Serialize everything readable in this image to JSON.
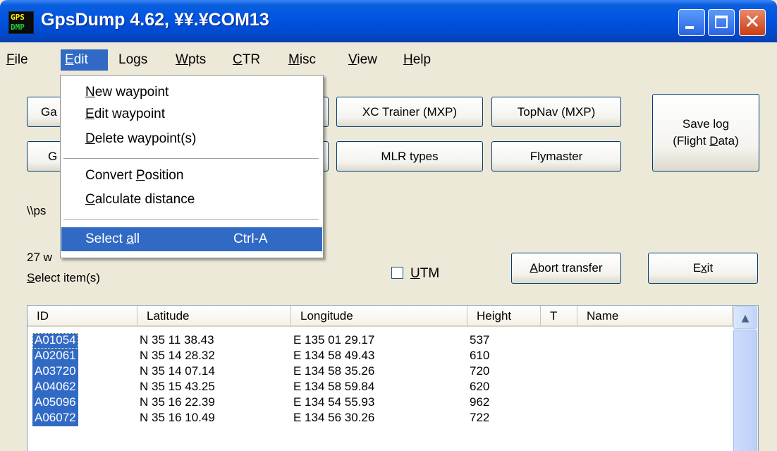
{
  "window": {
    "title": "GpsDump 4.62, ¥¥.¥COM13",
    "icon_text_top": "GPS",
    "icon_text_bottom": "DMP",
    "close_glyph": "✕"
  },
  "menubar": [
    {
      "pre": "",
      "mn": "F",
      "post": "ile"
    },
    {
      "pre": "",
      "mn": "E",
      "post": "dit"
    },
    {
      "pre": "Lo",
      "mn": "g",
      "post": "s"
    },
    {
      "pre": "",
      "mn": "W",
      "post": "pts"
    },
    {
      "pre": "",
      "mn": "C",
      "post": "TR"
    },
    {
      "pre": "",
      "mn": "M",
      "post": "isc"
    },
    {
      "pre": "",
      "mn": "V",
      "post": "iew"
    },
    {
      "pre": "",
      "mn": "H",
      "post": "elp"
    }
  ],
  "edit_menu": {
    "items": [
      {
        "pre": "",
        "mn": "N",
        "post": "ew waypoint",
        "shortcut": ""
      },
      {
        "pre": "",
        "mn": "E",
        "post": "dit waypoint",
        "shortcut": ""
      },
      {
        "pre": "",
        "mn": "D",
        "post": "elete waypoint(s)",
        "shortcut": ""
      },
      {
        "pre": "Convert ",
        "mn": "P",
        "post": "osition",
        "shortcut": ""
      },
      {
        "pre": "",
        "mn": "C",
        "post": "alculate distance",
        "shortcut": ""
      },
      {
        "pre": "Select ",
        "mn": "a",
        "post": "ll",
        "shortcut": "Ctrl-A"
      }
    ]
  },
  "buttons": {
    "left_top_partial": "Ga",
    "left_bottom_partial": "G",
    "xc_trainer": "XC Trainer (MXP)",
    "topnav": "TopNav (MXP)",
    "mlr_types": "MLR types",
    "flymaster": "Flymaster",
    "save_log_line1": "Save log",
    "save_log_line2_pre": "(Flight ",
    "save_log_line2_mn": "D",
    "save_log_line2_post": "ata)",
    "abort_pre": "",
    "abort_mn": "A",
    "abort_post": "bort transfer",
    "exit_pre": "E",
    "exit_mn": "x",
    "exit_post": "it"
  },
  "labels": {
    "path_partial": "\\\\ps",
    "count_partial": "27 w",
    "select_items_mn": "S",
    "select_items_post": "elect item(s)",
    "utm_mn": "U",
    "utm_post": "TM"
  },
  "utm_checked": false,
  "list": {
    "columns": [
      "ID",
      "Latitude",
      "Longitude",
      "Height",
      "T",
      "Name"
    ],
    "rows": [
      {
        "id": "A01054",
        "lat": "N 35  11  38.43",
        "lon": "E 135  01  29.17",
        "height": "537",
        "t": "",
        "name": ""
      },
      {
        "id": "A02061",
        "lat": "N 35  14  28.32",
        "lon": "E 134  58  49.43",
        "height": "610",
        "t": "",
        "name": ""
      },
      {
        "id": "A03720",
        "lat": "N 35  14  07.14",
        "lon": "E 134  58  35.26",
        "height": "720",
        "t": "",
        "name": ""
      },
      {
        "id": "A04062",
        "lat": "N 35  15  43.25",
        "lon": "E 134  58  59.84",
        "height": "620",
        "t": "",
        "name": ""
      },
      {
        "id": "A05096",
        "lat": "N 35  16  22.39",
        "lon": "E 134  54  55.93",
        "height": "962",
        "t": "",
        "name": ""
      },
      {
        "id": "A06072",
        "lat": "N 35  16  10.49",
        "lon": "E 134  56  30.26",
        "height": "722",
        "t": "",
        "name": ""
      }
    ],
    "scroll_up_glyph": "▲"
  },
  "colors": {
    "selection": "#316ac5",
    "titlebar": "#0054e3",
    "close_button": "#c93c12"
  }
}
